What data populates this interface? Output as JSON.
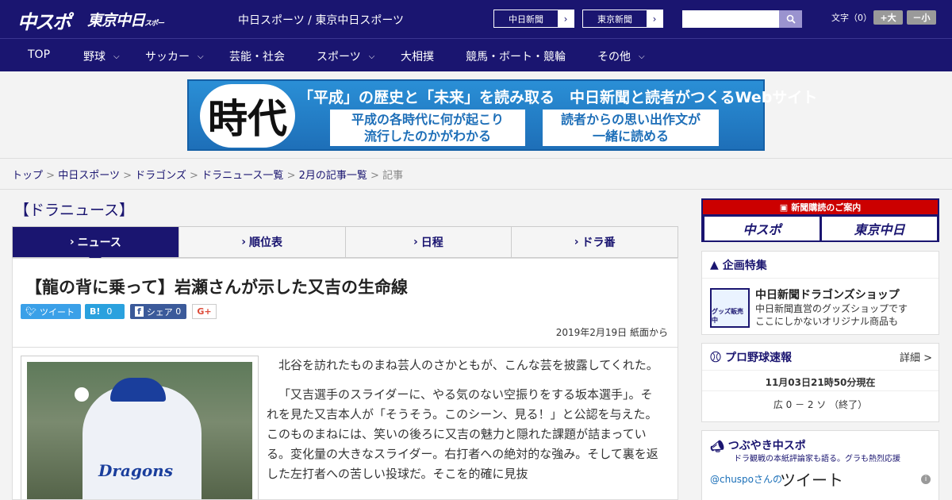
{
  "header": {
    "logo_chuspo": "中スポ",
    "logo_tokyo": "東京中日",
    "logo_tokyo_sub": "スポーツ",
    "site_title": "中日スポーツ / 東京中日スポーツ",
    "paper_links": [
      {
        "label": "中日新聞"
      },
      {
        "label": "東京新聞"
      }
    ],
    "search_placeholder": "",
    "font_size_label": "文字（0）",
    "font_larger": "+大",
    "font_smaller": "－小"
  },
  "nav": [
    {
      "label": "TOP",
      "has_dropdown": false
    },
    {
      "label": "野球",
      "has_dropdown": true
    },
    {
      "label": "サッカー",
      "has_dropdown": true
    },
    {
      "label": "芸能・社会",
      "has_dropdown": false
    },
    {
      "label": "スポーツ",
      "has_dropdown": true
    },
    {
      "label": "大相撲",
      "has_dropdown": false
    },
    {
      "label": "競馬・ボート・競輪",
      "has_dropdown": false
    },
    {
      "label": "その他",
      "has_dropdown": true
    }
  ],
  "banner": {
    "kanji": "時代",
    "headline": "「平成」の歴史と「未来」を読み取る　中日新聞と読者がつくるWebサイト",
    "box1_line1": "平成の各時代に何が起こり",
    "box1_line2": "流行したのかがわかる",
    "box2_line1": "読者からの思い出作文が",
    "box2_line2": "一緒に読める"
  },
  "breadcrumb": {
    "items": [
      "トップ",
      "中日スポーツ",
      "ドラゴンズ",
      "ドラニュース一覧",
      "2月の記事一覧"
    ],
    "current": "記事",
    "separator": ">"
  },
  "section_title": "【ドラニュース】",
  "tabs": [
    {
      "label": "ニュース",
      "active": true
    },
    {
      "label": "順位表",
      "active": false
    },
    {
      "label": "日程",
      "active": false
    },
    {
      "label": "ドラ番",
      "active": false
    }
  ],
  "article": {
    "title": "【龍の背に乗って】岩瀬さんが示した又吉の生命線",
    "share": {
      "tweet": "ツイート",
      "hatena": "B!",
      "hatena_count": "0",
      "facebook": "シェア",
      "facebook_count": "0",
      "gplus": "G+"
    },
    "dateline": "2019年2月19日 紙面から",
    "photo_logo": "Dragons",
    "paragraphs": [
      "北谷を訪れたものまね芸人のさかともが、こんな芸を披露してくれた。",
      "「又吉選手のスライダーに、やる気のない空振りをする坂本選手」。それを見た又吉本人が「そうそう。このシーン、見る！」と公認を与えた。このものまねには、笑いの後ろに又吉の魅力と隠れた課題が詰まっている。変化量の大きなスライダー。右打者への絶対的な強み。そして裏を返した左打者への苦しい投球だ。そこを的確に見抜"
    ]
  },
  "sidebar": {
    "subscribe_head": "新聞購読のご案内",
    "subscribe_btn1": "中スポ",
    "subscribe_btn2": "東京中日",
    "feature": {
      "heading": "企画特集",
      "shop_image_label": "グッズ販売中",
      "shop_title": "中日新聞ドラゴンズショップ",
      "shop_desc1": "中日新聞直営のグッズショップです",
      "shop_desc2": "ここにしかないオリジナル商品も"
    },
    "score": {
      "heading": "プロ野球速報",
      "more": "詳細 >",
      "time": "11月03日21時50分現在",
      "line": "広 0 － 2 ソ （終了）"
    },
    "twitter": {
      "heading": "つぶやき中スポ",
      "sub": "ドラ観戦の本紙評論家も語る。グラも熱烈応援",
      "handle": "@chuspoさんの",
      "label": "ツイート",
      "info": "i"
    }
  }
}
